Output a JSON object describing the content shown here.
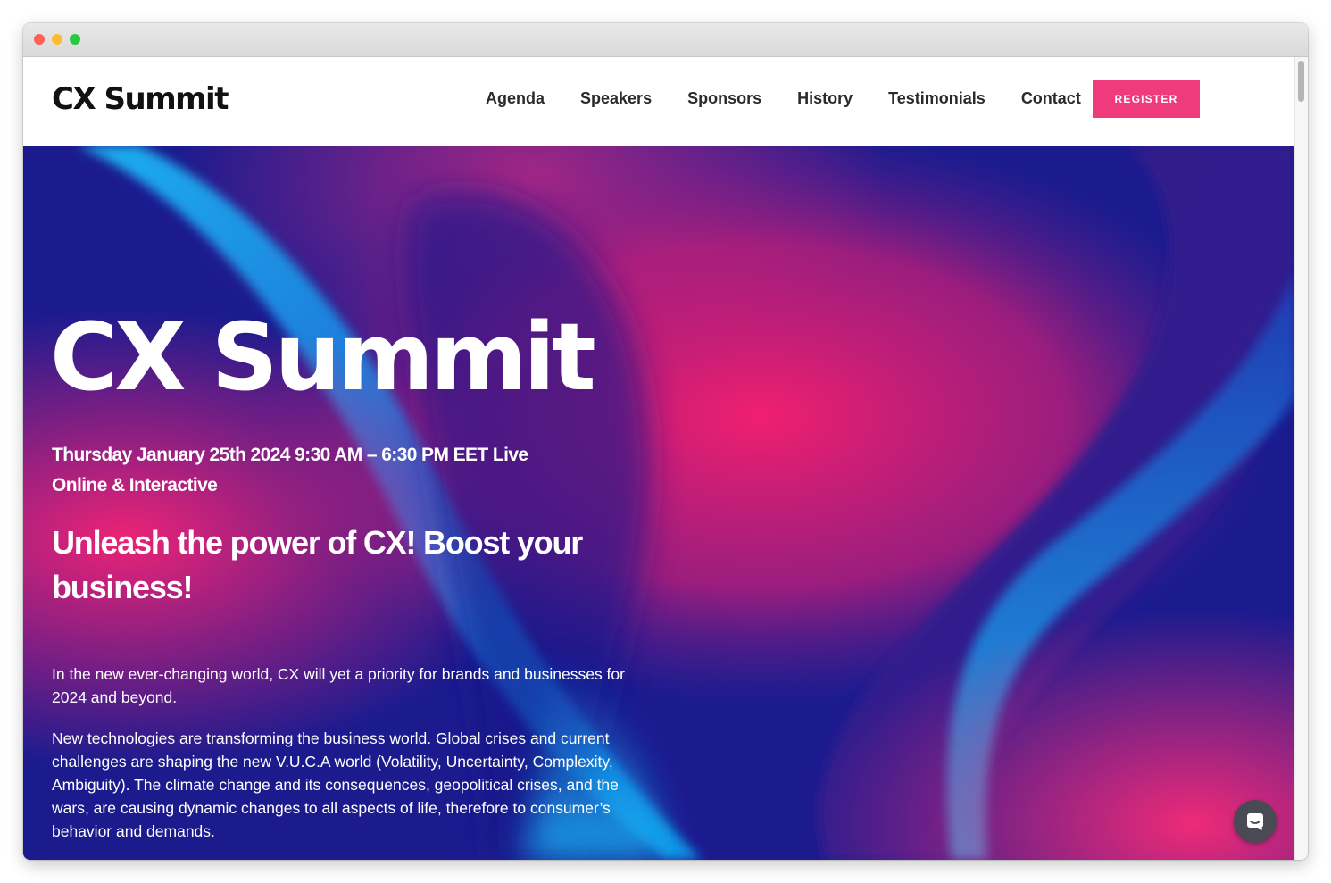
{
  "header": {
    "logo": "CX Summit",
    "nav": [
      {
        "label": "Agenda"
      },
      {
        "label": "Speakers"
      },
      {
        "label": "Sponsors"
      },
      {
        "label": "History"
      },
      {
        "label": "Testimonials"
      },
      {
        "label": "Contact"
      }
    ],
    "register_label": "REGISTER"
  },
  "hero": {
    "title": "CX Summit",
    "date": "Thursday January 25th 2024 9:30 AM – 6:30 PM EET Live Online & Interactive",
    "tagline": "Unleash the power of CX! Boost your business!",
    "paragraph_1": "In the new ever-changing world, CX will yet a priority for brands and businesses for 2024 and beyond.",
    "paragraph_2": "New technologies are transforming the business world. Global crises and current challenges are shaping the new V.U.C.A world (Volatility, Uncertainty, Complexity, Ambiguity). The climate change and its consequences, geopolitical crises, and the wars, are causing dynamic changes to all aspects of life, therefore to consumer’s behavior and demands."
  },
  "colors": {
    "accent": "#ef3a7b",
    "hero_blue": "#1b1a8c",
    "hero_pink": "#ec1f73",
    "hero_cyan": "#18b8f2",
    "hero_purple": "#5b1f8a"
  },
  "icons": {
    "chat": "chat-bubble-icon"
  }
}
